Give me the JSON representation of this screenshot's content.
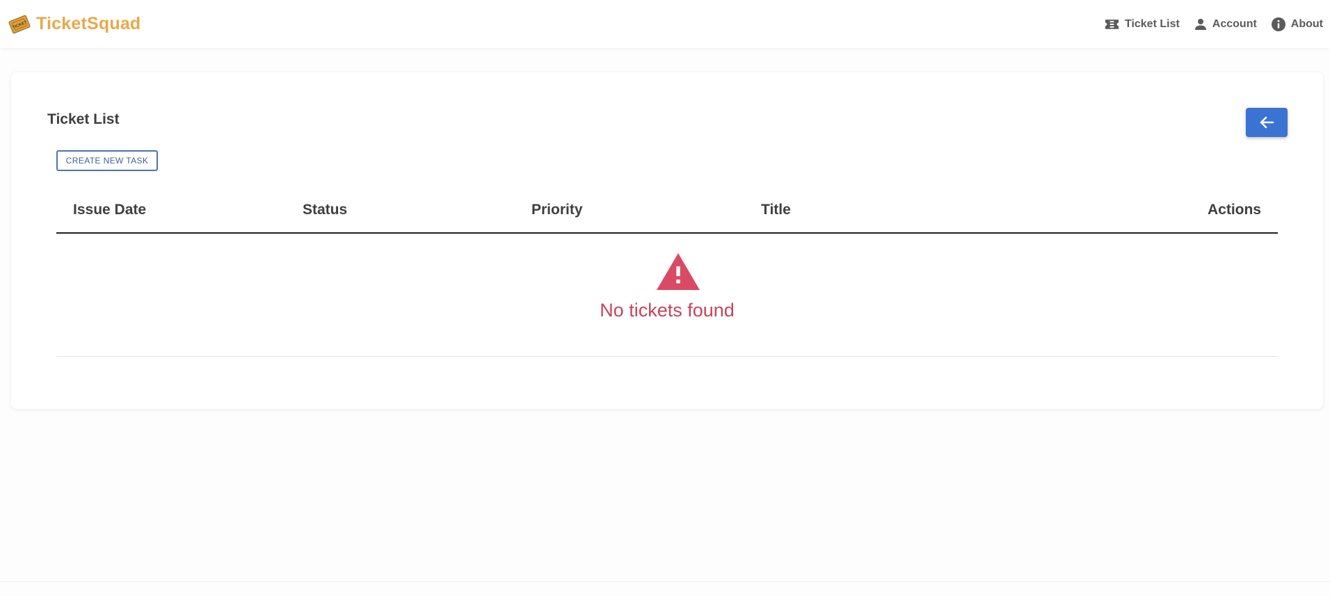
{
  "brand": {
    "name": "TicketSquad",
    "logo_icon": "ticket-logo-icon",
    "logo_text": "TICKET"
  },
  "nav": {
    "items": [
      {
        "label": "Ticket List",
        "icon": "ticket-icon"
      },
      {
        "label": "Account",
        "icon": "person-icon"
      },
      {
        "label": "About",
        "icon": "info-icon"
      }
    ]
  },
  "page": {
    "title": "Ticket List",
    "back_icon": "arrow-left-icon",
    "create_label": "CREATE NEW TASK"
  },
  "table": {
    "columns": [
      "Issue Date",
      "Status",
      "Priority",
      "Title",
      "Actions"
    ],
    "rows": []
  },
  "empty_state": {
    "icon": "warning-icon",
    "message": "No tickets found"
  },
  "colors": {
    "brand": "#e9a84c",
    "primary": "#3a73d1",
    "danger": "#d94b65",
    "outline": "#4c72b0"
  }
}
